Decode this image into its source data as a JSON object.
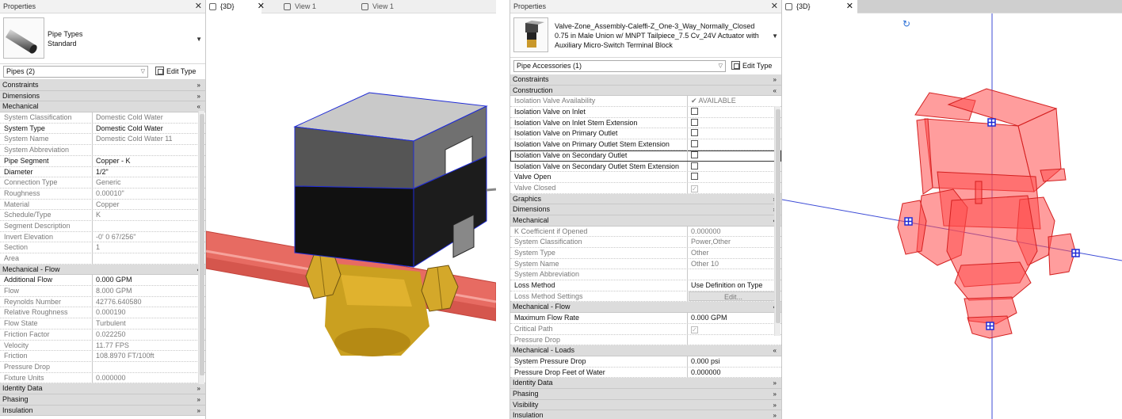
{
  "left_panel": {
    "title": "Properties",
    "type_name": "Pipe Types",
    "type_sub": "Standard",
    "selector": "Pipes (2)",
    "edit_type": "Edit Type",
    "rows": [
      {
        "kind": "group",
        "label": "Constraints",
        "chev": "»"
      },
      {
        "kind": "group",
        "label": "Dimensions",
        "chev": "»"
      },
      {
        "kind": "group",
        "label": "Mechanical",
        "chev": "«"
      },
      {
        "kind": "row",
        "name": "System Classification",
        "value": "Domestic Cold Water",
        "gray": true
      },
      {
        "kind": "row",
        "name": "System Type",
        "value": "Domestic Cold Water",
        "gray": false
      },
      {
        "kind": "row",
        "name": "System Name",
        "value": "Domestic Cold Water 11",
        "gray": true
      },
      {
        "kind": "row",
        "name": "System Abbreviation",
        "value": "",
        "gray": true
      },
      {
        "kind": "row",
        "name": "Pipe Segment",
        "value": "Copper - K",
        "gray": false
      },
      {
        "kind": "row",
        "name": "Diameter",
        "value": "1/2\"",
        "gray": false
      },
      {
        "kind": "row",
        "name": "Connection Type",
        "value": "Generic",
        "gray": true
      },
      {
        "kind": "row",
        "name": "Roughness",
        "value": "0.00010\"",
        "gray": true
      },
      {
        "kind": "row",
        "name": "Material",
        "value": "Copper",
        "gray": true
      },
      {
        "kind": "row",
        "name": "Schedule/Type",
        "value": "K",
        "gray": true
      },
      {
        "kind": "row",
        "name": "Segment Description",
        "value": "",
        "gray": true
      },
      {
        "kind": "row",
        "name": "Invert Elevation",
        "value": "-0' 0 67/256\"",
        "gray": true
      },
      {
        "kind": "row",
        "name": "Section",
        "value": "1",
        "gray": true
      },
      {
        "kind": "row",
        "name": "Area",
        "value": "",
        "gray": true
      },
      {
        "kind": "group",
        "label": "Mechanical - Flow",
        "chev": "«"
      },
      {
        "kind": "row",
        "name": "Additional Flow",
        "value": "0.000 GPM",
        "gray": false
      },
      {
        "kind": "row",
        "name": "Flow",
        "value": "8.000 GPM",
        "gray": true
      },
      {
        "kind": "row",
        "name": "Reynolds Number",
        "value": "42776.640580",
        "gray": true
      },
      {
        "kind": "row",
        "name": "Relative Roughness",
        "value": "0.000190",
        "gray": true
      },
      {
        "kind": "row",
        "name": "Flow State",
        "value": "Turbulent",
        "gray": true
      },
      {
        "kind": "row",
        "name": "Friction Factor",
        "value": "0.022250",
        "gray": true
      },
      {
        "kind": "row",
        "name": "Velocity",
        "value": "11.77 FPS",
        "gray": true
      },
      {
        "kind": "row",
        "name": "Friction",
        "value": "108.8970 FT/100ft",
        "gray": true
      },
      {
        "kind": "row",
        "name": "Pressure Drop",
        "value": "",
        "gray": true
      },
      {
        "kind": "row",
        "name": "Fixture Units",
        "value": "0.000000",
        "gray": true
      },
      {
        "kind": "group",
        "label": "Identity Data",
        "chev": "»"
      },
      {
        "kind": "group",
        "label": "Phasing",
        "chev": "»"
      },
      {
        "kind": "group",
        "label": "Insulation",
        "chev": "»"
      }
    ]
  },
  "view_left": {
    "tabs": [
      {
        "label": "{3D}",
        "active": true,
        "close": "✕"
      },
      {
        "label": "View 1",
        "active": false,
        "close": "✕"
      },
      {
        "label": "View 1",
        "active": false,
        "close": ""
      }
    ]
  },
  "right_panel": {
    "title": "Properties",
    "type_lines": [
      "Valve-Zone_Assembly-Caleffi-Z_One-3_Way_Normally_Closed",
      "0.75 in Male Union w/ MNPT Tailpiece_7.5 Cv_24V Actuator with",
      "Auxiliary Micro-Switch Terminal Block"
    ],
    "selector": "Pipe Accessories (1)",
    "edit_type": "Edit Type",
    "rows": [
      {
        "kind": "group",
        "label": "Constraints",
        "chev": "»"
      },
      {
        "kind": "group",
        "label": "Construction",
        "chev": "«"
      },
      {
        "kind": "row",
        "name": "Isolation Valve Availability",
        "value": "✔ AVAILABLE",
        "gray": true
      },
      {
        "kind": "row",
        "name": "Isolation Valve on Inlet",
        "value": "",
        "check": true,
        "gray": false
      },
      {
        "kind": "row",
        "name": "Isolation Valve on Inlet Stem Extension",
        "value": "",
        "check": true,
        "gray": false
      },
      {
        "kind": "row",
        "name": "Isolation Valve on Primary Outlet",
        "value": "",
        "check": true,
        "gray": false
      },
      {
        "kind": "row",
        "name": "Isolation Valve on Primary Outlet Stem Extension",
        "value": "",
        "check": true,
        "gray": false
      },
      {
        "kind": "row",
        "name": "Isolation Valve on Secondary Outlet",
        "value": "",
        "check": true,
        "gray": false,
        "selected": true
      },
      {
        "kind": "row",
        "name": "Isolation Valve on Secondary Outlet Stem Extension",
        "value": "",
        "check": true,
        "gray": false
      },
      {
        "kind": "row",
        "name": "Valve Open",
        "value": "",
        "check": true,
        "gray": false
      },
      {
        "kind": "row",
        "name": "Valve Closed",
        "value": "",
        "check": true,
        "gray": true,
        "checked": true
      },
      {
        "kind": "group",
        "label": "Graphics",
        "chev": "»"
      },
      {
        "kind": "group",
        "label": "Dimensions",
        "chev": "»"
      },
      {
        "kind": "group",
        "label": "Mechanical",
        "chev": "«"
      },
      {
        "kind": "row",
        "name": "K Coefficient if Opened",
        "value": "0.000000",
        "gray": true
      },
      {
        "kind": "row",
        "name": "System Classification",
        "value": "Power,Other",
        "gray": true
      },
      {
        "kind": "row",
        "name": "System Type",
        "value": "Other",
        "gray": true
      },
      {
        "kind": "row",
        "name": "System Name",
        "value": "Other 10",
        "gray": true
      },
      {
        "kind": "row",
        "name": "System Abbreviation",
        "value": "",
        "gray": true
      },
      {
        "kind": "row",
        "name": "Loss Method",
        "value": "Use Definition on Type",
        "gray": false
      },
      {
        "kind": "row",
        "name": "Loss Method Settings",
        "value": "Edit...",
        "gray": true,
        "button": true
      },
      {
        "kind": "group",
        "label": "Mechanical - Flow",
        "chev": "«"
      },
      {
        "kind": "row",
        "name": "Maximum Flow Rate",
        "value": "0.000 GPM",
        "gray": false
      },
      {
        "kind": "row",
        "name": "Critical Path",
        "value": "",
        "check": true,
        "gray": true,
        "checked": true
      },
      {
        "kind": "row",
        "name": "Pressure Drop",
        "value": "",
        "gray": true
      },
      {
        "kind": "group",
        "label": "Mechanical - Loads",
        "chev": "«"
      },
      {
        "kind": "row",
        "name": "System Pressure Drop",
        "value": "0.000 psi",
        "gray": false
      },
      {
        "kind": "row",
        "name": "Pressure Drop Feet of Water",
        "value": "0.000000",
        "gray": false
      },
      {
        "kind": "group",
        "label": "Identity Data",
        "chev": "»"
      },
      {
        "kind": "group",
        "label": "Phasing",
        "chev": "»"
      },
      {
        "kind": "group",
        "label": "Visibility",
        "chev": "»"
      },
      {
        "kind": "group",
        "label": "Insulation",
        "chev": "»"
      }
    ]
  },
  "view_right": {
    "tabs": [
      {
        "label": "{3D}",
        "active": true,
        "close": "✕"
      }
    ]
  },
  "colors": {
    "red_fill": "#ff5a5a",
    "copper_pipe": "#e25a52",
    "brass": "#d9a520",
    "actuator_top": "#c8c8c8",
    "actuator_front": "#5a5a5a",
    "axis": "#3c4bd6"
  }
}
